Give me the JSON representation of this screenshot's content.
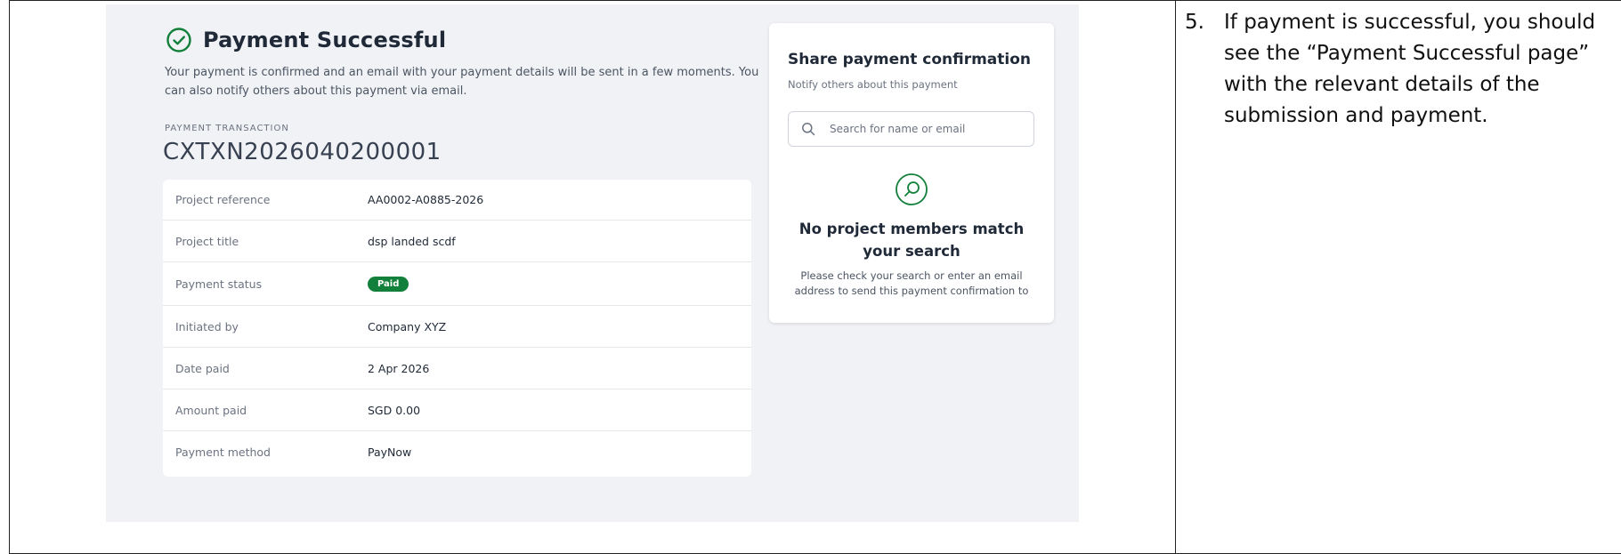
{
  "header": {
    "title": "Payment Successful",
    "subtitle": "Your payment is confirmed and an email with your payment details will be sent in a few moments. You can also notify others about this payment via email."
  },
  "transaction": {
    "label": "PAYMENT TRANSACTION",
    "value": "CXTXN2026040200001"
  },
  "details": [
    {
      "label": "Project reference",
      "value": "AA0002-A0885-2026"
    },
    {
      "label": "Project title",
      "value": "dsp landed scdf"
    },
    {
      "label": "Payment status",
      "value": "Paid",
      "badge": true
    },
    {
      "label": "Initiated by",
      "value": "Company XYZ"
    },
    {
      "label": "Date paid",
      "value": "2 Apr 2026"
    },
    {
      "label": "Amount paid",
      "value": "SGD 0.00"
    },
    {
      "label": "Payment method",
      "value": "PayNow"
    }
  ],
  "share": {
    "title": "Share payment confirmation",
    "subtitle": "Notify others about this payment",
    "search_placeholder": "Search for name or email",
    "empty_title": "No project members match your search",
    "empty_desc": "Please check your search or enter an email address to send this payment confirmation to"
  },
  "instruction": {
    "number": "5.",
    "text": "If payment is successful, you should see the “Payment Successful page” with the relevant details of the submission and payment."
  },
  "colors": {
    "success_green": "#12803a",
    "panel_bg": "#f1f2f5"
  },
  "icons": {
    "header": "check-circle-icon",
    "search": "search-icon",
    "empty_state": "magnifier-circle-icon"
  }
}
